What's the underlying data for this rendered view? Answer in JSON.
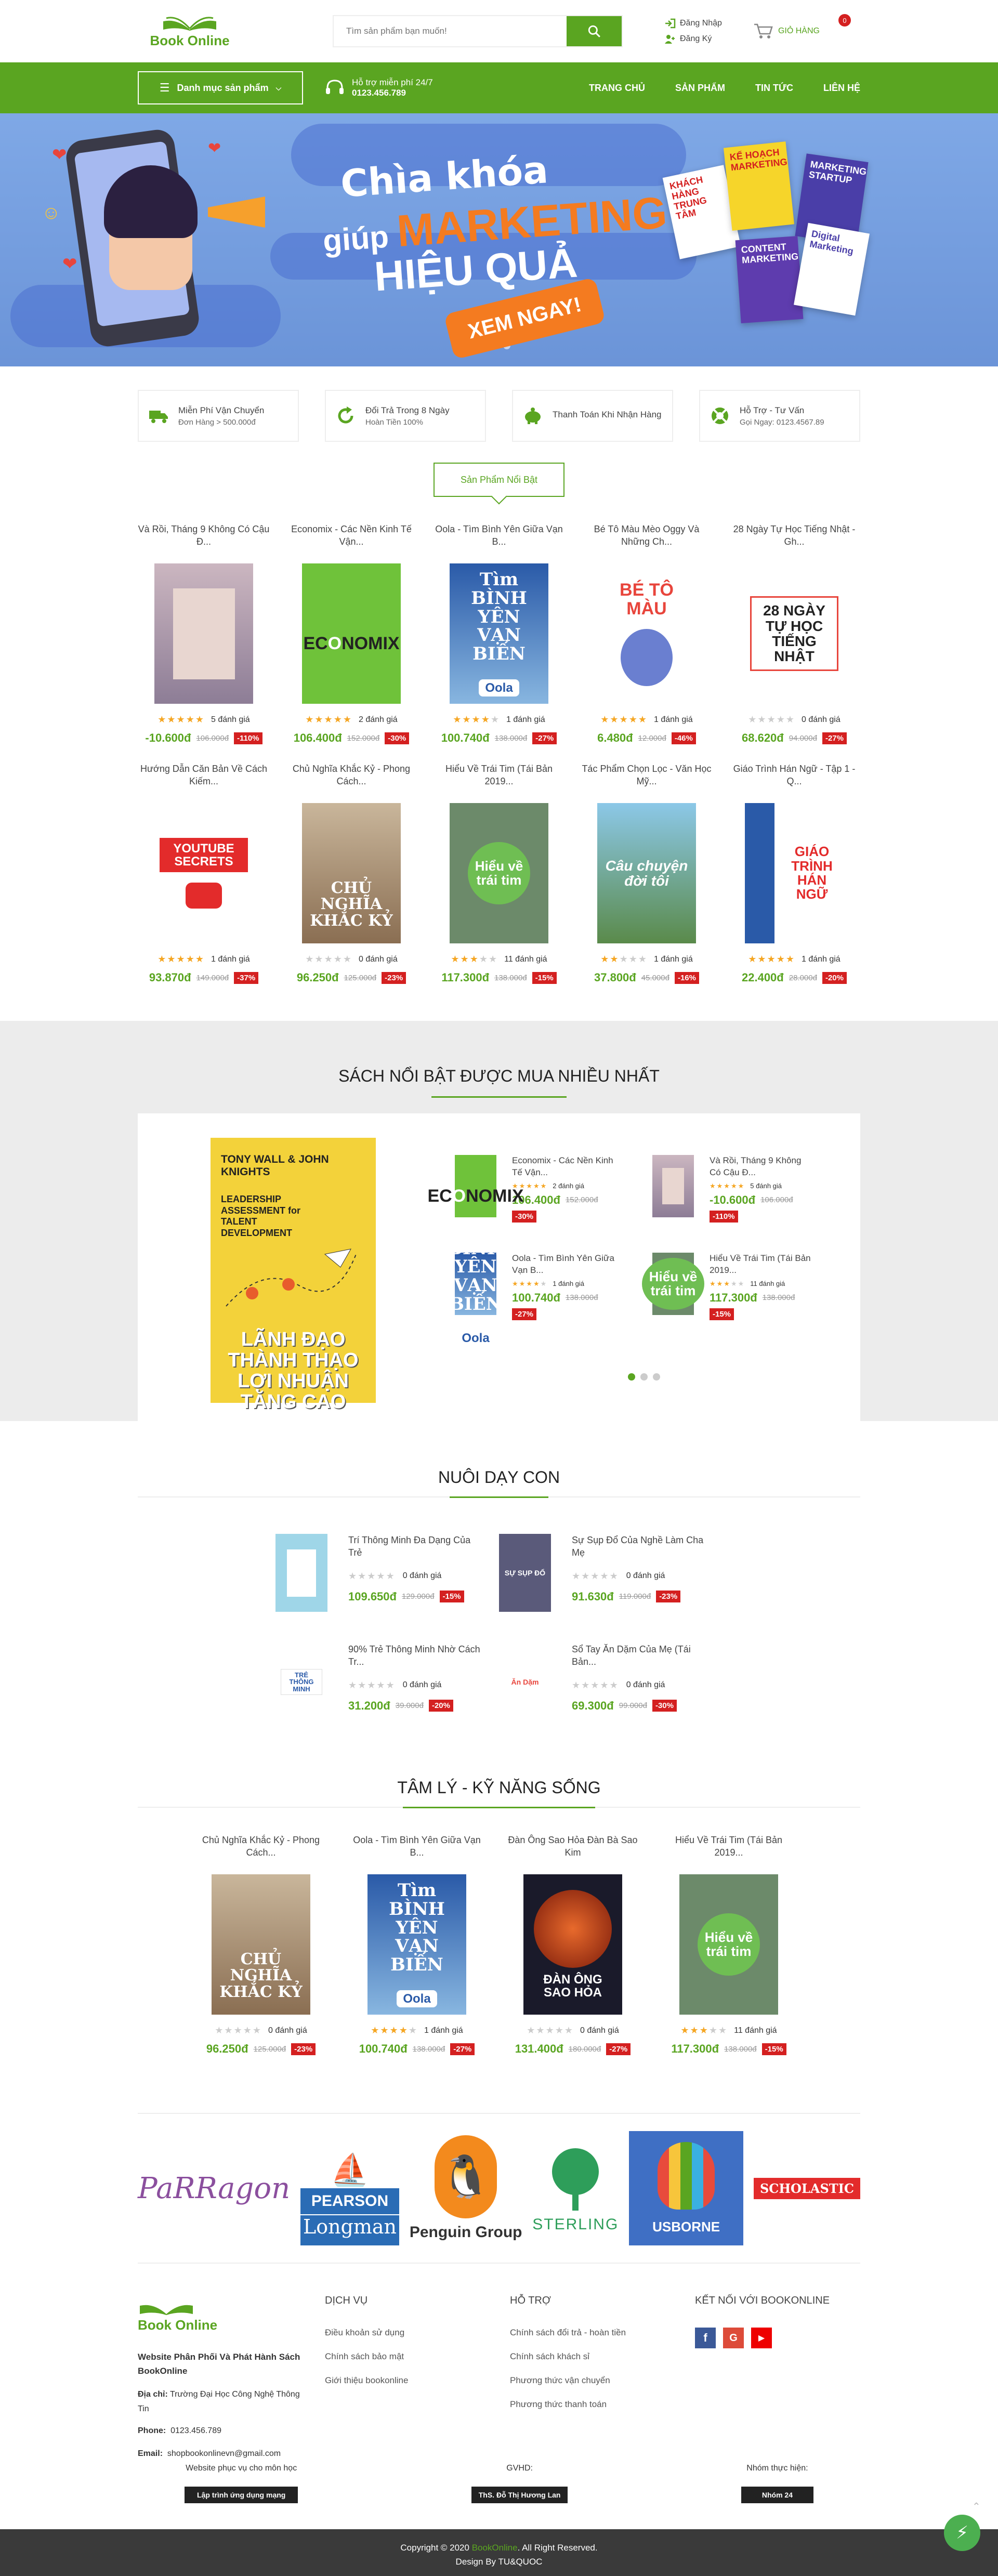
{
  "header": {
    "logo_text": "Book Online",
    "search_placeholder": "Tìm sản phẩm bạn muốn!",
    "login": "Đăng Nhập",
    "register": "Đăng Ký",
    "cart_label": "GIỎ HÀNG",
    "cart_count": "0"
  },
  "nav": {
    "category_btn": "Danh mục sản phẩm",
    "support_line1": "Hỗ trợ miễn phí 24/7",
    "support_line2": "0123.456.789",
    "menu": [
      "TRANG CHỦ",
      "SẢN PHẨM",
      "TIN TỨC",
      "LIÊN HỆ"
    ]
  },
  "banner": {
    "line1": "Chìa khóa",
    "line2a": "giúp",
    "line2b": "MARKETING",
    "line3": "HIỆU QUẢ",
    "button": "XEM NGAY!",
    "books": [
      "KẾ HOẠCH MARKETING",
      "KHÁCH HÀNG TRUNG TÂM",
      "MARKETING STARTUP",
      "Digital Marketing",
      "CONTENT MARKETING"
    ]
  },
  "policies": [
    {
      "title": "Miễn Phí Vận Chuyển",
      "sub": "Đơn Hàng > 500.000đ"
    },
    {
      "title": "Đổi Trả Trong 8 Ngày",
      "sub": "Hoàn Tiền 100%"
    },
    {
      "title": "Thanh Toán Khi Nhận Hàng",
      "sub": ""
    },
    {
      "title": "Hỗ Trợ - Tư Vấn",
      "sub": "Gọi Ngay: 0123.4567.89"
    }
  ],
  "featured_title": "Sản Phẩm Nổi Bật",
  "featured": [
    {
      "name": "Và Rồi, Tháng 9 Không Có Cậu Đ...",
      "stars": 5,
      "reviews": "5 đánh giá",
      "price": "-10.600đ",
      "old": "106.000đ",
      "off": "-110%",
      "cover": "c1"
    },
    {
      "name": "Economix - Các Nền Kinh Tế Vận...",
      "stars": 5,
      "reviews": "2 đánh giá",
      "price": "106.400đ",
      "old": "152.000đ",
      "off": "-30%",
      "cover": "c2"
    },
    {
      "name": "Oola - Tìm Bình Yên Giữa Vạn B...",
      "stars": 4,
      "reviews": "1 đánh giá",
      "price": "100.740đ",
      "old": "138.000đ",
      "off": "-27%",
      "cover": "c3"
    },
    {
      "name": "Bé Tô Màu Mèo Oggy Và Những Ch...",
      "stars": 5,
      "reviews": "1 đánh giá",
      "price": "6.480đ",
      "old": "12.000đ",
      "off": "-46%",
      "cover": "c4"
    },
    {
      "name": "28 Ngày Tự Học Tiếng Nhật - Gh...",
      "stars": 0,
      "reviews": "0 đánh giá",
      "price": "68.620đ",
      "old": "94.000đ",
      "off": "-27%",
      "cover": "c5"
    },
    {
      "name": "Hướng Dẫn Căn Bản Về Cách Kiếm...",
      "stars": 5,
      "reviews": "1 đánh giá",
      "price": "93.870đ",
      "old": "149.000đ",
      "off": "-37%",
      "cover": "c6"
    },
    {
      "name": "Chủ Nghĩa Khắc Kỷ - Phong Cách...",
      "stars": 0,
      "reviews": "0 đánh giá",
      "price": "96.250đ",
      "old": "125.000đ",
      "off": "-23%",
      "cover": "c7"
    },
    {
      "name": "Hiểu Về Trái Tim (Tái Bản 2019...",
      "stars": 3,
      "reviews": "11 đánh giá",
      "price": "117.300đ",
      "old": "138.000đ",
      "off": "-15%",
      "cover": "c8"
    },
    {
      "name": "Tác Phẩm Chọn Lọc - Văn Học Mỹ...",
      "stars": 2,
      "reviews": "1 đánh giá",
      "price": "37.800đ",
      "old": "45.000đ",
      "off": "-16%",
      "cover": "c9"
    },
    {
      "name": "Giáo Trình Hán Ngữ - Tập 1 - Q...",
      "stars": 5,
      "reviews": "1 đánh giá",
      "price": "22.400đ",
      "old": "28.000đ",
      "off": "-20%",
      "cover": "c10"
    }
  ],
  "best": {
    "title": "SÁCH NỔI BẬT ĐƯỢC MUA NHIỀU NHẤT",
    "big_book": {
      "author": "TONY WALL & JOHN KNIGHTS",
      "sub": "LEADERSHIP ASSESSMENT for TALENT DEVELOPMENT",
      "title": "LÃNH ĐẠO THÀNH THẠO LỢI NHUẬN TĂNG CAO"
    },
    "items": [
      {
        "name": "Economix - Các Nền Kinh Tế Vận...",
        "stars": 5,
        "reviews": "2 đánh giá",
        "price": "106.400đ",
        "old": "152.000đ",
        "off": "-30%",
        "cover": "c2"
      },
      {
        "name": "Và Rồi, Tháng 9 Không Có Cậu Đ...",
        "stars": 5,
        "reviews": "5 đánh giá",
        "price": "-10.600đ",
        "old": "106.000đ",
        "off": "-110%",
        "cover": "c1"
      },
      {
        "name": "Oola - Tìm Bình Yên Giữa Vạn B...",
        "stars": 4,
        "reviews": "1 đánh giá",
        "price": "100.740đ",
        "old": "138.000đ",
        "off": "-27%",
        "cover": "c3"
      },
      {
        "name": "Hiểu Về Trái Tim (Tái Bản 2019...",
        "stars": 3,
        "reviews": "11 đánh giá",
        "price": "117.300đ",
        "old": "138.000đ",
        "off": "-15%",
        "cover": "c8"
      }
    ]
  },
  "nuoi": {
    "title": "NUÔI DẠY CON",
    "items": [
      {
        "name": "Trí Thông Minh Đa Dạng Của Trẻ",
        "stars": 0,
        "reviews": "0 đánh giá",
        "price": "109.650đ",
        "old": "129.000đ",
        "off": "-15%",
        "cover": "n1"
      },
      {
        "name": "Sự Sụp Đổ Của Nghề Làm Cha Mẹ",
        "stars": 0,
        "reviews": "0 đánh giá",
        "price": "91.630đ",
        "old": "119.000đ",
        "off": "-23%",
        "cover": "n2"
      },
      {
        "name": "90% Trẻ Thông Minh Nhờ Cách Tr...",
        "stars": 0,
        "reviews": "0 đánh giá",
        "price": "31.200đ",
        "old": "39.000đ",
        "off": "-20%",
        "cover": "n3"
      },
      {
        "name": "Sổ Tay Ăn Dặm Của Mẹ (Tái Bản...",
        "stars": 0,
        "reviews": "0 đánh giá",
        "price": "69.300đ",
        "old": "99.000đ",
        "off": "-30%",
        "cover": "n4"
      }
    ]
  },
  "tamly": {
    "title": "TÂM LÝ - KỸ NĂNG SỐNG",
    "items": [
      {
        "name": "Chủ Nghĩa Khắc Kỷ - Phong Cách...",
        "stars": 0,
        "reviews": "0 đánh giá",
        "price": "96.250đ",
        "old": "125.000đ",
        "off": "-23%",
        "cover": "c7"
      },
      {
        "name": "Oola - Tìm Bình Yên Giữa Vạn B...",
        "stars": 4,
        "reviews": "1 đánh giá",
        "price": "100.740đ",
        "old": "138.000đ",
        "off": "-27%",
        "cover": "c3"
      },
      {
        "name": "Đàn Ông Sao Hỏa Đàn Bà Sao Kim",
        "stars": 0,
        "reviews": "0 đánh giá",
        "price": "131.400đ",
        "old": "180.000đ",
        "off": "-27%",
        "cover": "t3"
      },
      {
        "name": "Hiểu Về Trái Tim (Tái Bản 2019...",
        "stars": 3,
        "reviews": "11 đánh giá",
        "price": "117.300đ",
        "old": "138.000đ",
        "off": "-15%",
        "cover": "c8"
      }
    ]
  },
  "brands": [
    "PaRRagon",
    "PEARSON",
    "Longman",
    "Penguin Group",
    "STERLING",
    "USBORNE",
    "SCHOLASTIC"
  ],
  "footer": {
    "logo": "Book Online",
    "desc": "Website Phân Phối Và Phát Hành Sách BookOnline",
    "addr_label": "Địa chỉ:",
    "addr": "Trường Đại Học Công Nghệ Thông Tin",
    "phone_label": "Phone:",
    "phone": "0123.456.789",
    "email_label": "Email:",
    "email": "shopbookonlinevn@gmail.com",
    "col2_title": "DỊCH VỤ",
    "col2": [
      "Điều khoản sử dụng",
      "Chính sách bảo mật",
      "Giới thiệu bookonline"
    ],
    "col3_title": "HỖ TRỢ",
    "col3": [
      "Chính sách đổi trả - hoàn tiền",
      "Chính sách khách sỉ",
      "Phương thức vận chuyển",
      "Phương thức thanh toán"
    ],
    "col4_title": "KẾT NỐI VỚI BOOKONLINE",
    "b1_label": "Website phục vụ cho môn học",
    "b1_btn": "Lập trình ứng dụng mạng",
    "b2_label": "GVHD:",
    "b2_btn": "ThS. Đỗ Thị Hương Lan",
    "b3_label": "Nhóm thực hiện:",
    "b3_btn": "Nhóm 24",
    "copy1a": "Copyright © 2020",
    "copy1b": "BookOnline",
    "copy1c": ". All Right Reserved.",
    "copy2": "Design By TU&QUOC"
  }
}
